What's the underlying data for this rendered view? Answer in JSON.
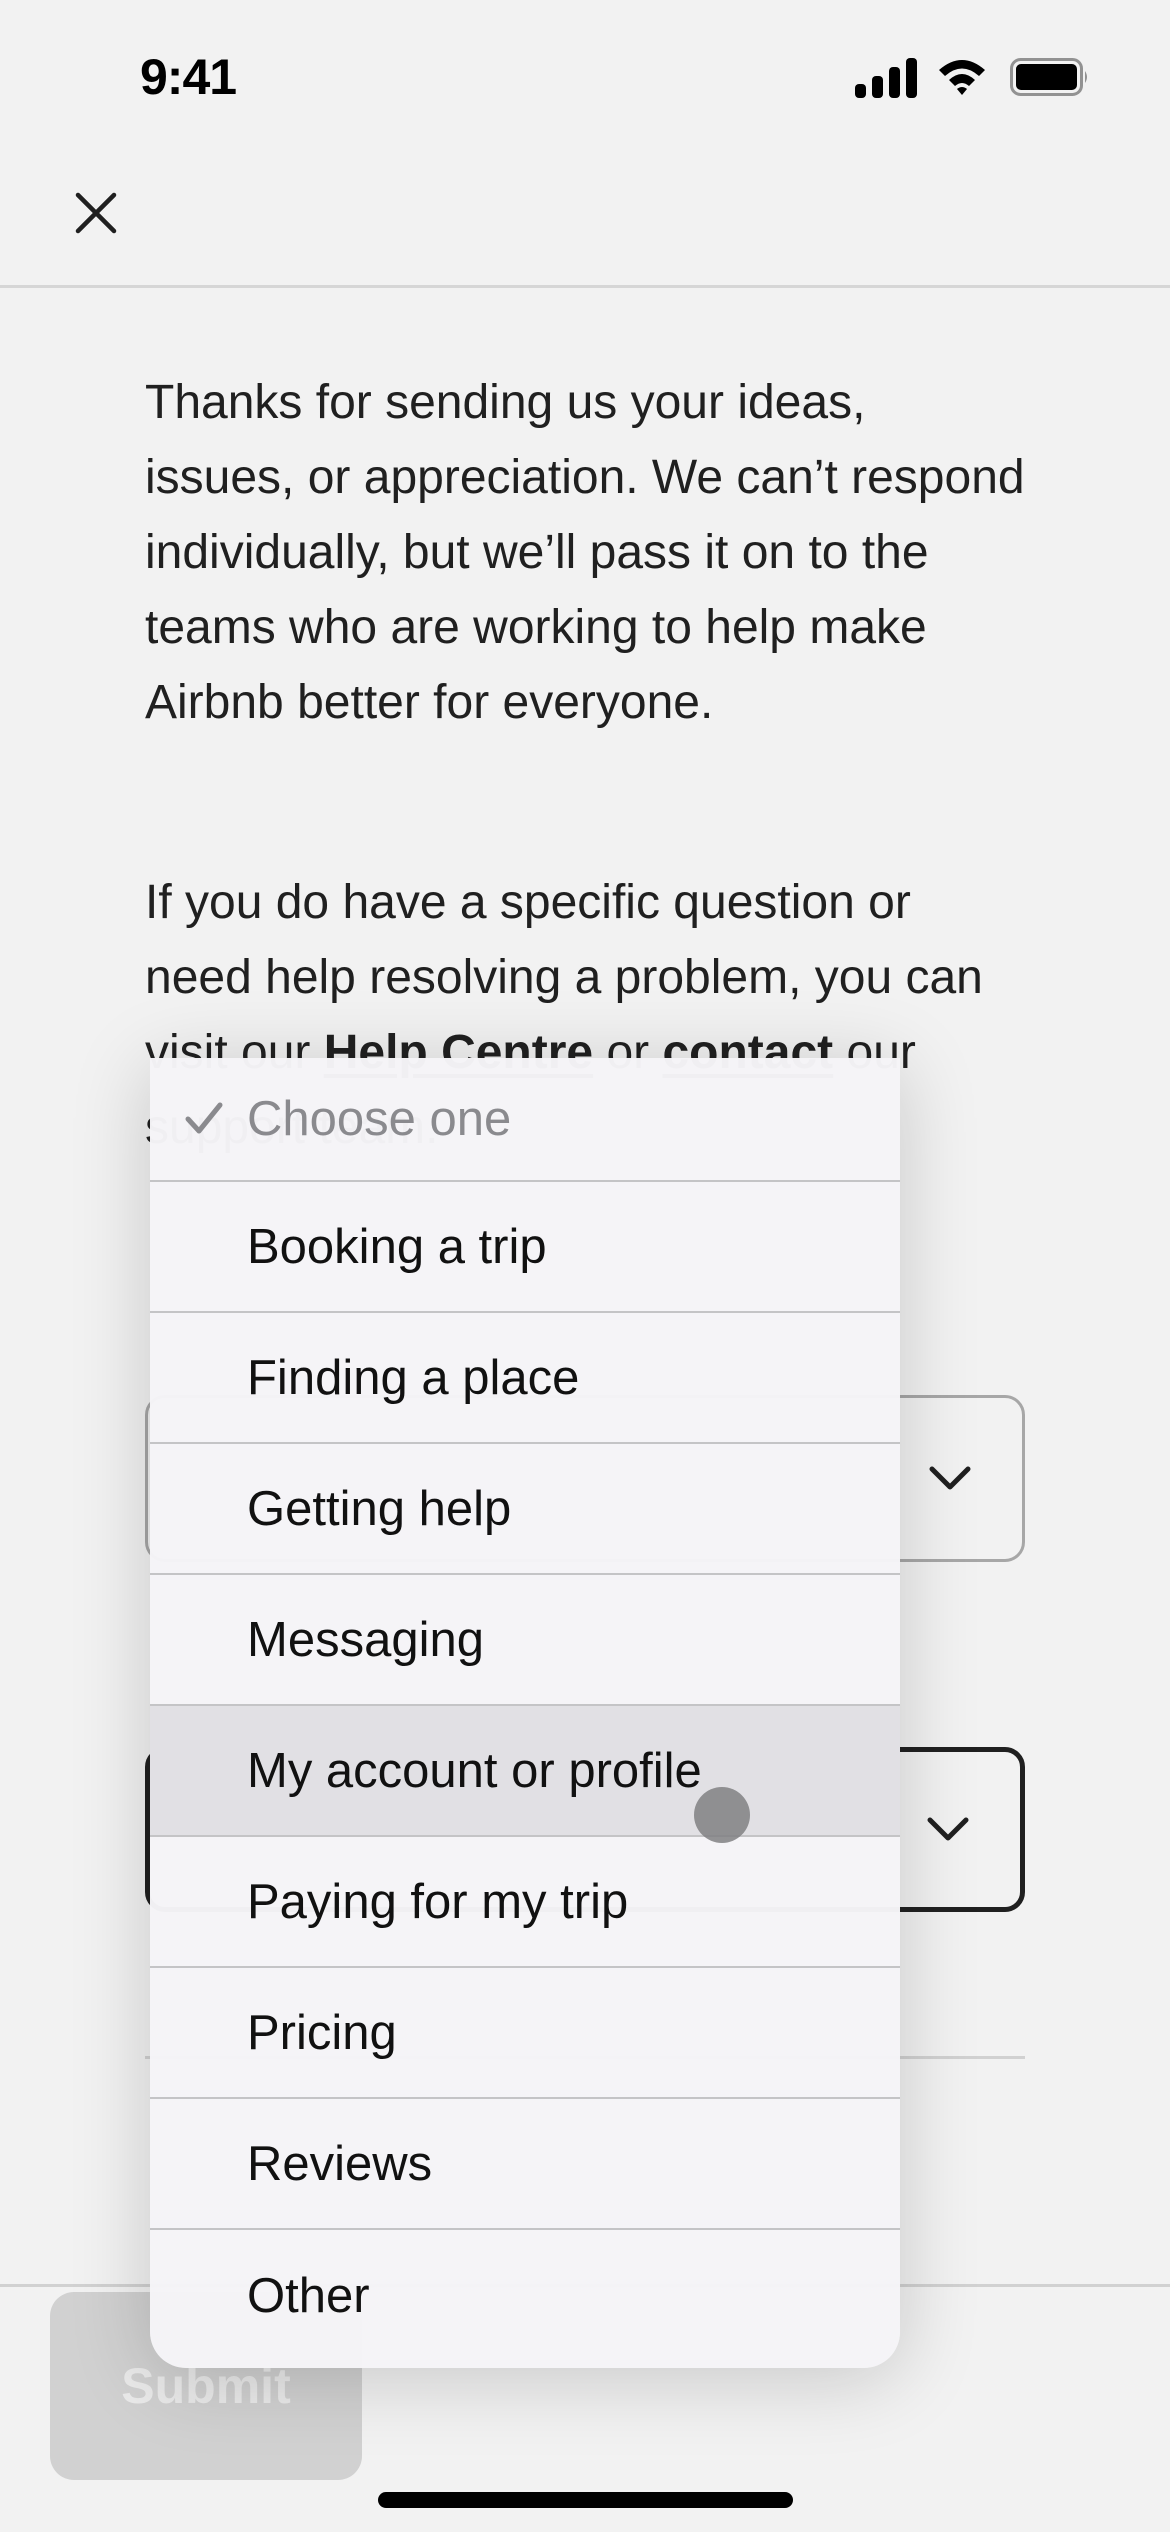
{
  "status_bar": {
    "time": "9:41",
    "icons": [
      "cellular-signal-icon",
      "wifi-icon",
      "battery-icon"
    ]
  },
  "header": {
    "close_icon": "close-icon"
  },
  "intro": {
    "paragraph_1": "Thanks for sending us your ideas, issues, or appreciation. We can’t respond individually, but we’ll pass it on to the teams who are working to help make Airbnb better for everyone.",
    "paragraph_2_prefix": "If you do have a specific question or need help resolving a problem, you can visit our ",
    "help_centre_link": "Help Centre",
    "paragraph_2_middle": " or ",
    "contact_link": "contact",
    "paragraph_2_suffix": " our support team."
  },
  "form": {
    "select_1_icon": "chevron-down-icon",
    "select_2_icon": "chevron-down-icon"
  },
  "footer": {
    "submit_label": "Submit",
    "submit_disabled": true
  },
  "dropdown": {
    "selected": "Choose one",
    "highlighted": "My account or profile",
    "options": [
      {
        "label": "Choose one",
        "checked": true,
        "placeholder": true
      },
      {
        "label": "Booking a trip"
      },
      {
        "label": "Finding a place"
      },
      {
        "label": "Getting help"
      },
      {
        "label": "Messaging"
      },
      {
        "label": "My account or profile",
        "highlighted": true
      },
      {
        "label": "Paying for my trip"
      },
      {
        "label": "Pricing"
      },
      {
        "label": "Reviews"
      },
      {
        "label": "Other"
      }
    ]
  },
  "colors": {
    "text_primary": "#222222",
    "placeholder_gray": "#8a8a8e",
    "disabled_button": "#dddddd",
    "menu_background": "#f5f4f7",
    "menu_highlight": "#e1e0e4"
  }
}
